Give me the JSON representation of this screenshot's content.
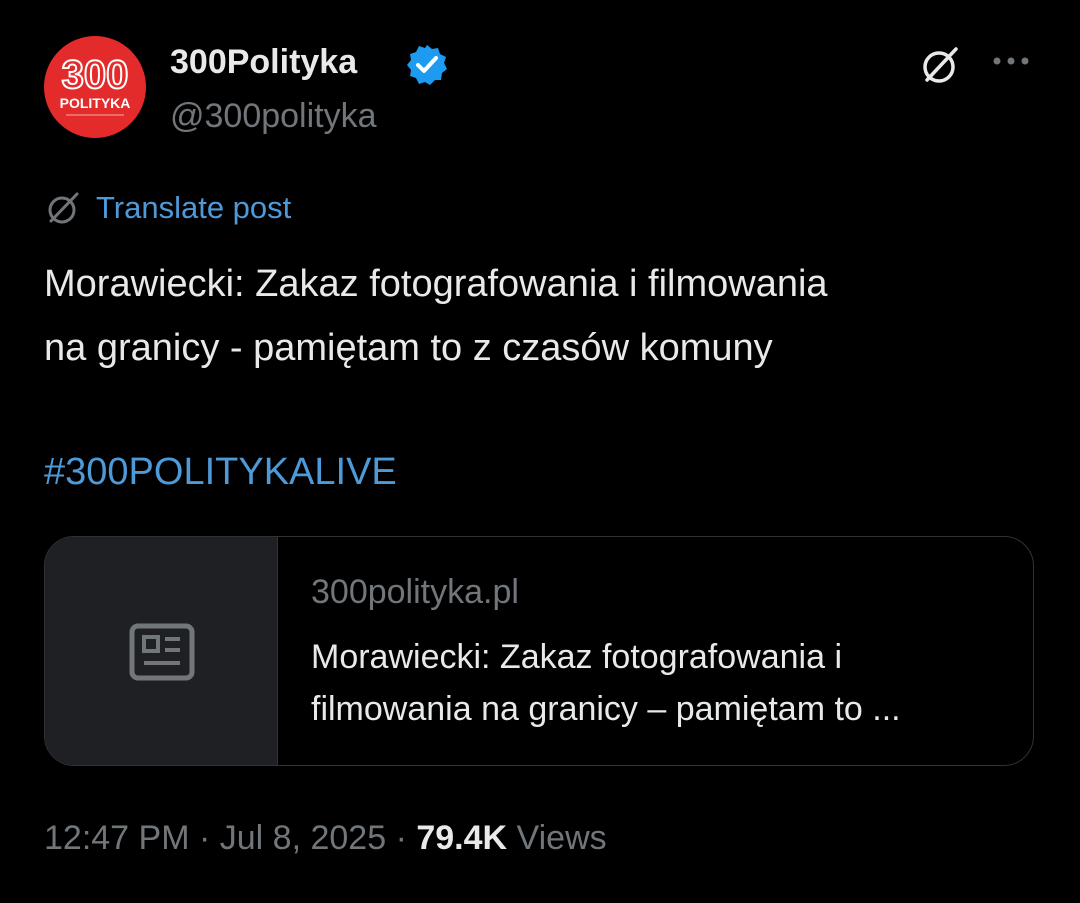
{
  "author": {
    "display_name": "300Polityka",
    "handle": "@300polityka",
    "avatar_text": {
      "number": "300",
      "word": "POLITYKA"
    },
    "verified": true
  },
  "actions": {
    "grok_icon": "grok-icon",
    "more_icon": "more-icon"
  },
  "translate": {
    "label": "Translate post",
    "icon": "grok-icon"
  },
  "post": {
    "text_lines": [
      "Morawiecki: Zakaz fotografowania i filmowania",
      "na granicy - pamiętam to z czasów komuny"
    ],
    "hashtag": "#300POLITYKALIVE"
  },
  "link_card": {
    "icon": "newspaper-icon",
    "domain": "300polityka.pl",
    "title_lines": [
      "Morawiecki: Zakaz fotografowania i",
      "filmowania na granicy – pamiętam to ..."
    ]
  },
  "meta": {
    "time": "12:47 PM",
    "date": "Jul 8, 2025",
    "separator": "·",
    "views_count": "79.4K",
    "views_label": "Views"
  },
  "colors": {
    "background": "#000000",
    "text_primary": "#e7e9ea",
    "text_secondary": "#71767b",
    "link": "#4e9ad9",
    "verified": "#1d9bf0",
    "avatar_red": "#e32b2b",
    "card_border": "#2f3336",
    "card_thumb": "#1e2024"
  }
}
